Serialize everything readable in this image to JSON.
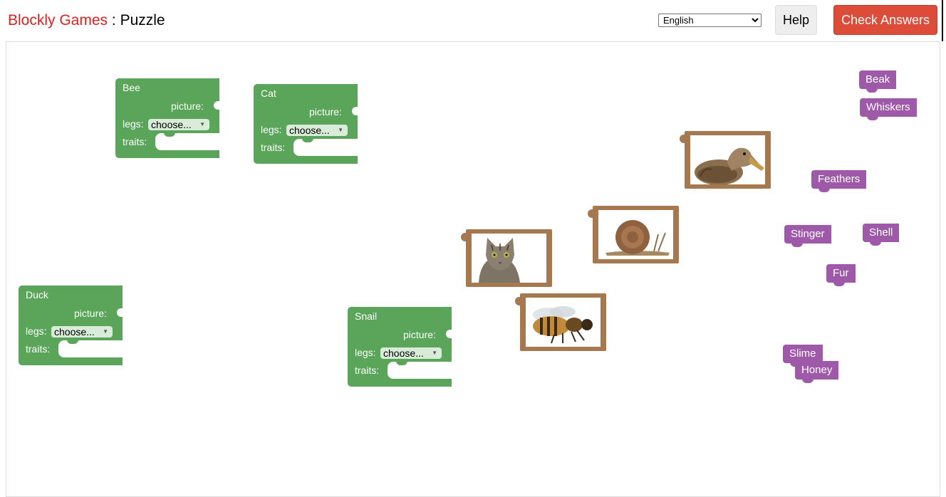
{
  "header": {
    "app_name": "Blockly Games",
    "separator": " : ",
    "page_name": "Puzzle",
    "language_selected": "English",
    "help_label": "Help",
    "check_label": "Check Answers"
  },
  "animal_blocks": [
    {
      "name": "Bee",
      "picture_label": "picture:",
      "legs_label": "legs:",
      "legs_value": "choose...",
      "traits_label": "traits:"
    },
    {
      "name": "Cat",
      "picture_label": "picture:",
      "legs_label": "legs:",
      "legs_value": "choose...",
      "traits_label": "traits:"
    },
    {
      "name": "Duck",
      "picture_label": "picture:",
      "legs_label": "legs:",
      "legs_value": "choose...",
      "traits_label": "traits:"
    },
    {
      "name": "Snail",
      "picture_label": "picture:",
      "legs_label": "legs:",
      "legs_value": "choose...",
      "traits_label": "traits:"
    }
  ],
  "picture_blocks": [
    {
      "subject": "duck-picture"
    },
    {
      "subject": "snail-picture"
    },
    {
      "subject": "cat-picture"
    },
    {
      "subject": "bee-picture"
    }
  ],
  "trait_blocks": [
    "Beak",
    "Whiskers",
    "Feathers",
    "Stinger",
    "Shell",
    "Fur",
    "Slime",
    "Honey"
  ],
  "colors": {
    "animal_block": "#5ba55b",
    "picture_block": "#a5784f",
    "trait_block": "#9e5aa8",
    "check_button": "#dd4b39",
    "app_name": "#dd1f1f"
  }
}
